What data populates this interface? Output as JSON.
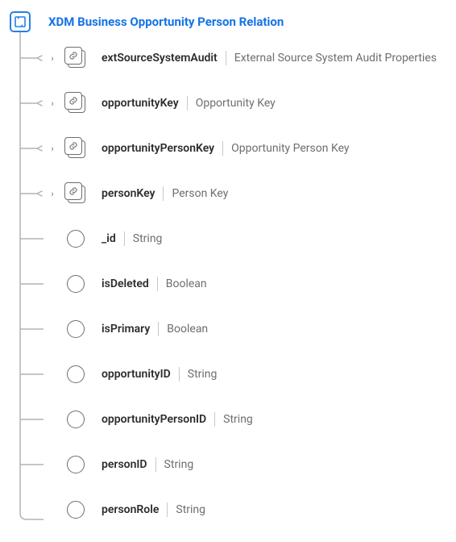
{
  "root": {
    "title": "XDM Business Opportunity Person Relation"
  },
  "fields": [
    {
      "name": "extSourceSystemAudit",
      "type": "External Source System Audit Properties",
      "kind": "object",
      "expandable": true
    },
    {
      "name": "opportunityKey",
      "type": "Opportunity Key",
      "kind": "object",
      "expandable": true
    },
    {
      "name": "opportunityPersonKey",
      "type": "Opportunity Person Key",
      "kind": "object",
      "expandable": true
    },
    {
      "name": "personKey",
      "type": "Person Key",
      "kind": "object",
      "expandable": true
    },
    {
      "name": "_id",
      "type": "String",
      "kind": "leaf",
      "expandable": false
    },
    {
      "name": "isDeleted",
      "type": "Boolean",
      "kind": "leaf",
      "expandable": false
    },
    {
      "name": "isPrimary",
      "type": "Boolean",
      "kind": "leaf",
      "expandable": false
    },
    {
      "name": "opportunityID",
      "type": "String",
      "kind": "leaf",
      "expandable": false
    },
    {
      "name": "opportunityPersonID",
      "type": "String",
      "kind": "leaf",
      "expandable": false
    },
    {
      "name": "personID",
      "type": "String",
      "kind": "leaf",
      "expandable": false
    },
    {
      "name": "personRole",
      "type": "String",
      "kind": "leaf",
      "expandable": false
    }
  ]
}
